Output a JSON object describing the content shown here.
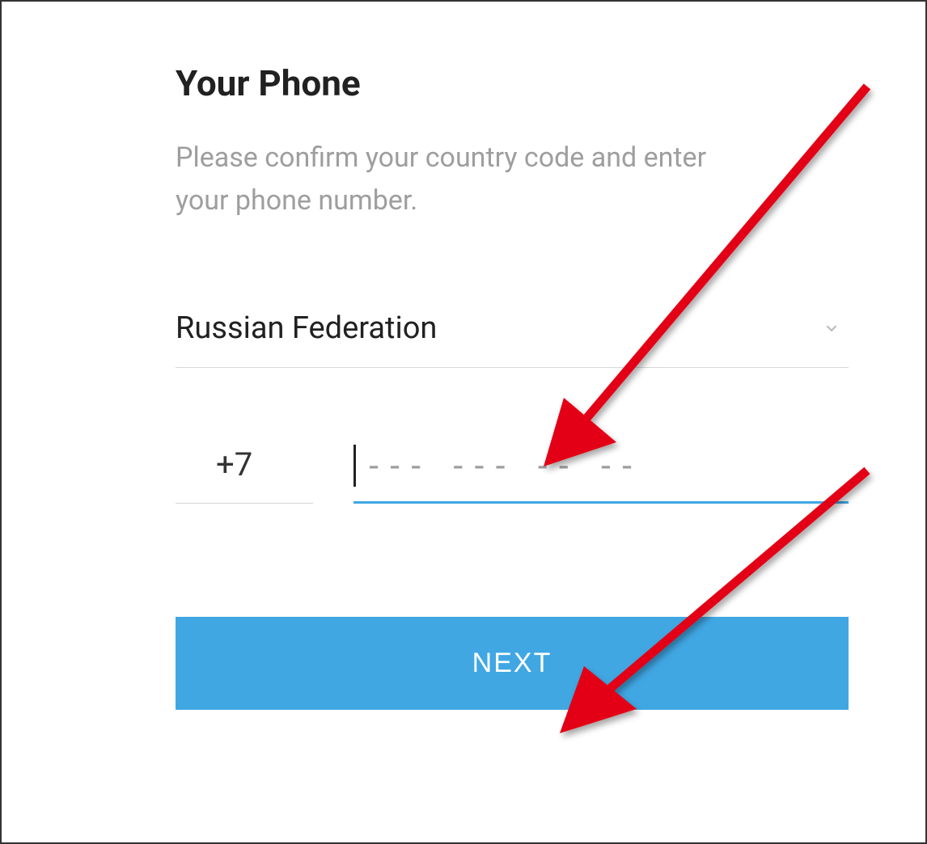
{
  "header": {
    "title": "Your Phone",
    "subtitle": "Please confirm your country code and enter your phone number."
  },
  "country": {
    "selected": "Russian Federation"
  },
  "phone": {
    "code": "+7",
    "placeholder": "--- --- -- --",
    "value": ""
  },
  "buttons": {
    "next": "NEXT"
  },
  "colors": {
    "accent": "#40a7e3",
    "annotation": "#e30613"
  }
}
